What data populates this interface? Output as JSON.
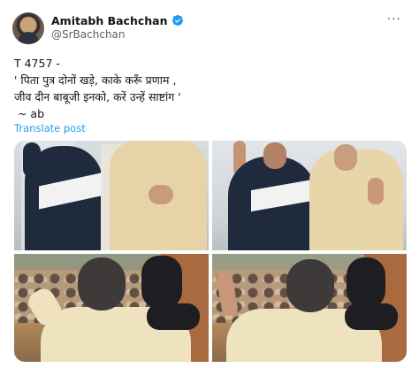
{
  "tweet": {
    "author_name": "Amitabh Bachchan",
    "handle": "@SrBachchan",
    "more_icon": "more-horizontal-icon",
    "verified_color": "#1d9bf0",
    "lines": [
      "T 4757 -",
      "' पिता पुत्र दोनों खड़े, काके करूँ प्रणाम ,",
      "जीव दीन बाबूजी इनको, करें उन्हें साष्टांग '",
      " ~ ab"
    ],
    "translate_label": "Translate post",
    "link_color": "#1d9bf0",
    "photos": [
      "photo-1",
      "photo-2",
      "photo-3",
      "photo-4"
    ]
  }
}
